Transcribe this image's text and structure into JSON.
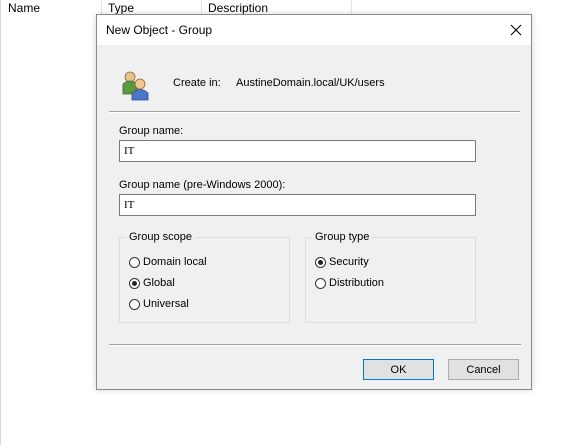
{
  "background": {
    "columns": [
      "Name",
      "Type",
      "Description"
    ]
  },
  "dialog": {
    "title": "New Object - Group",
    "close_icon": "close-icon",
    "group_icon": "users-group-icon",
    "create_in_label": "Create in:",
    "create_in_path": "AustineDomain.local/UK/users",
    "group_name_label": "Group name:",
    "group_name_value": "IT",
    "group_name_pre2000_label": "Group name (pre-Windows 2000):",
    "group_name_pre2000_value": "IT",
    "group_scope": {
      "title": "Group scope",
      "options": [
        "Domain local",
        "Global",
        "Universal"
      ],
      "selected": "Global"
    },
    "group_type": {
      "title": "Group type",
      "options": [
        "Security",
        "Distribution"
      ],
      "selected": "Security"
    },
    "ok_label": "OK",
    "cancel_label": "Cancel"
  },
  "colors": {
    "dialog_bg": "#f0f0f0",
    "focus_border": "#0078d7"
  }
}
